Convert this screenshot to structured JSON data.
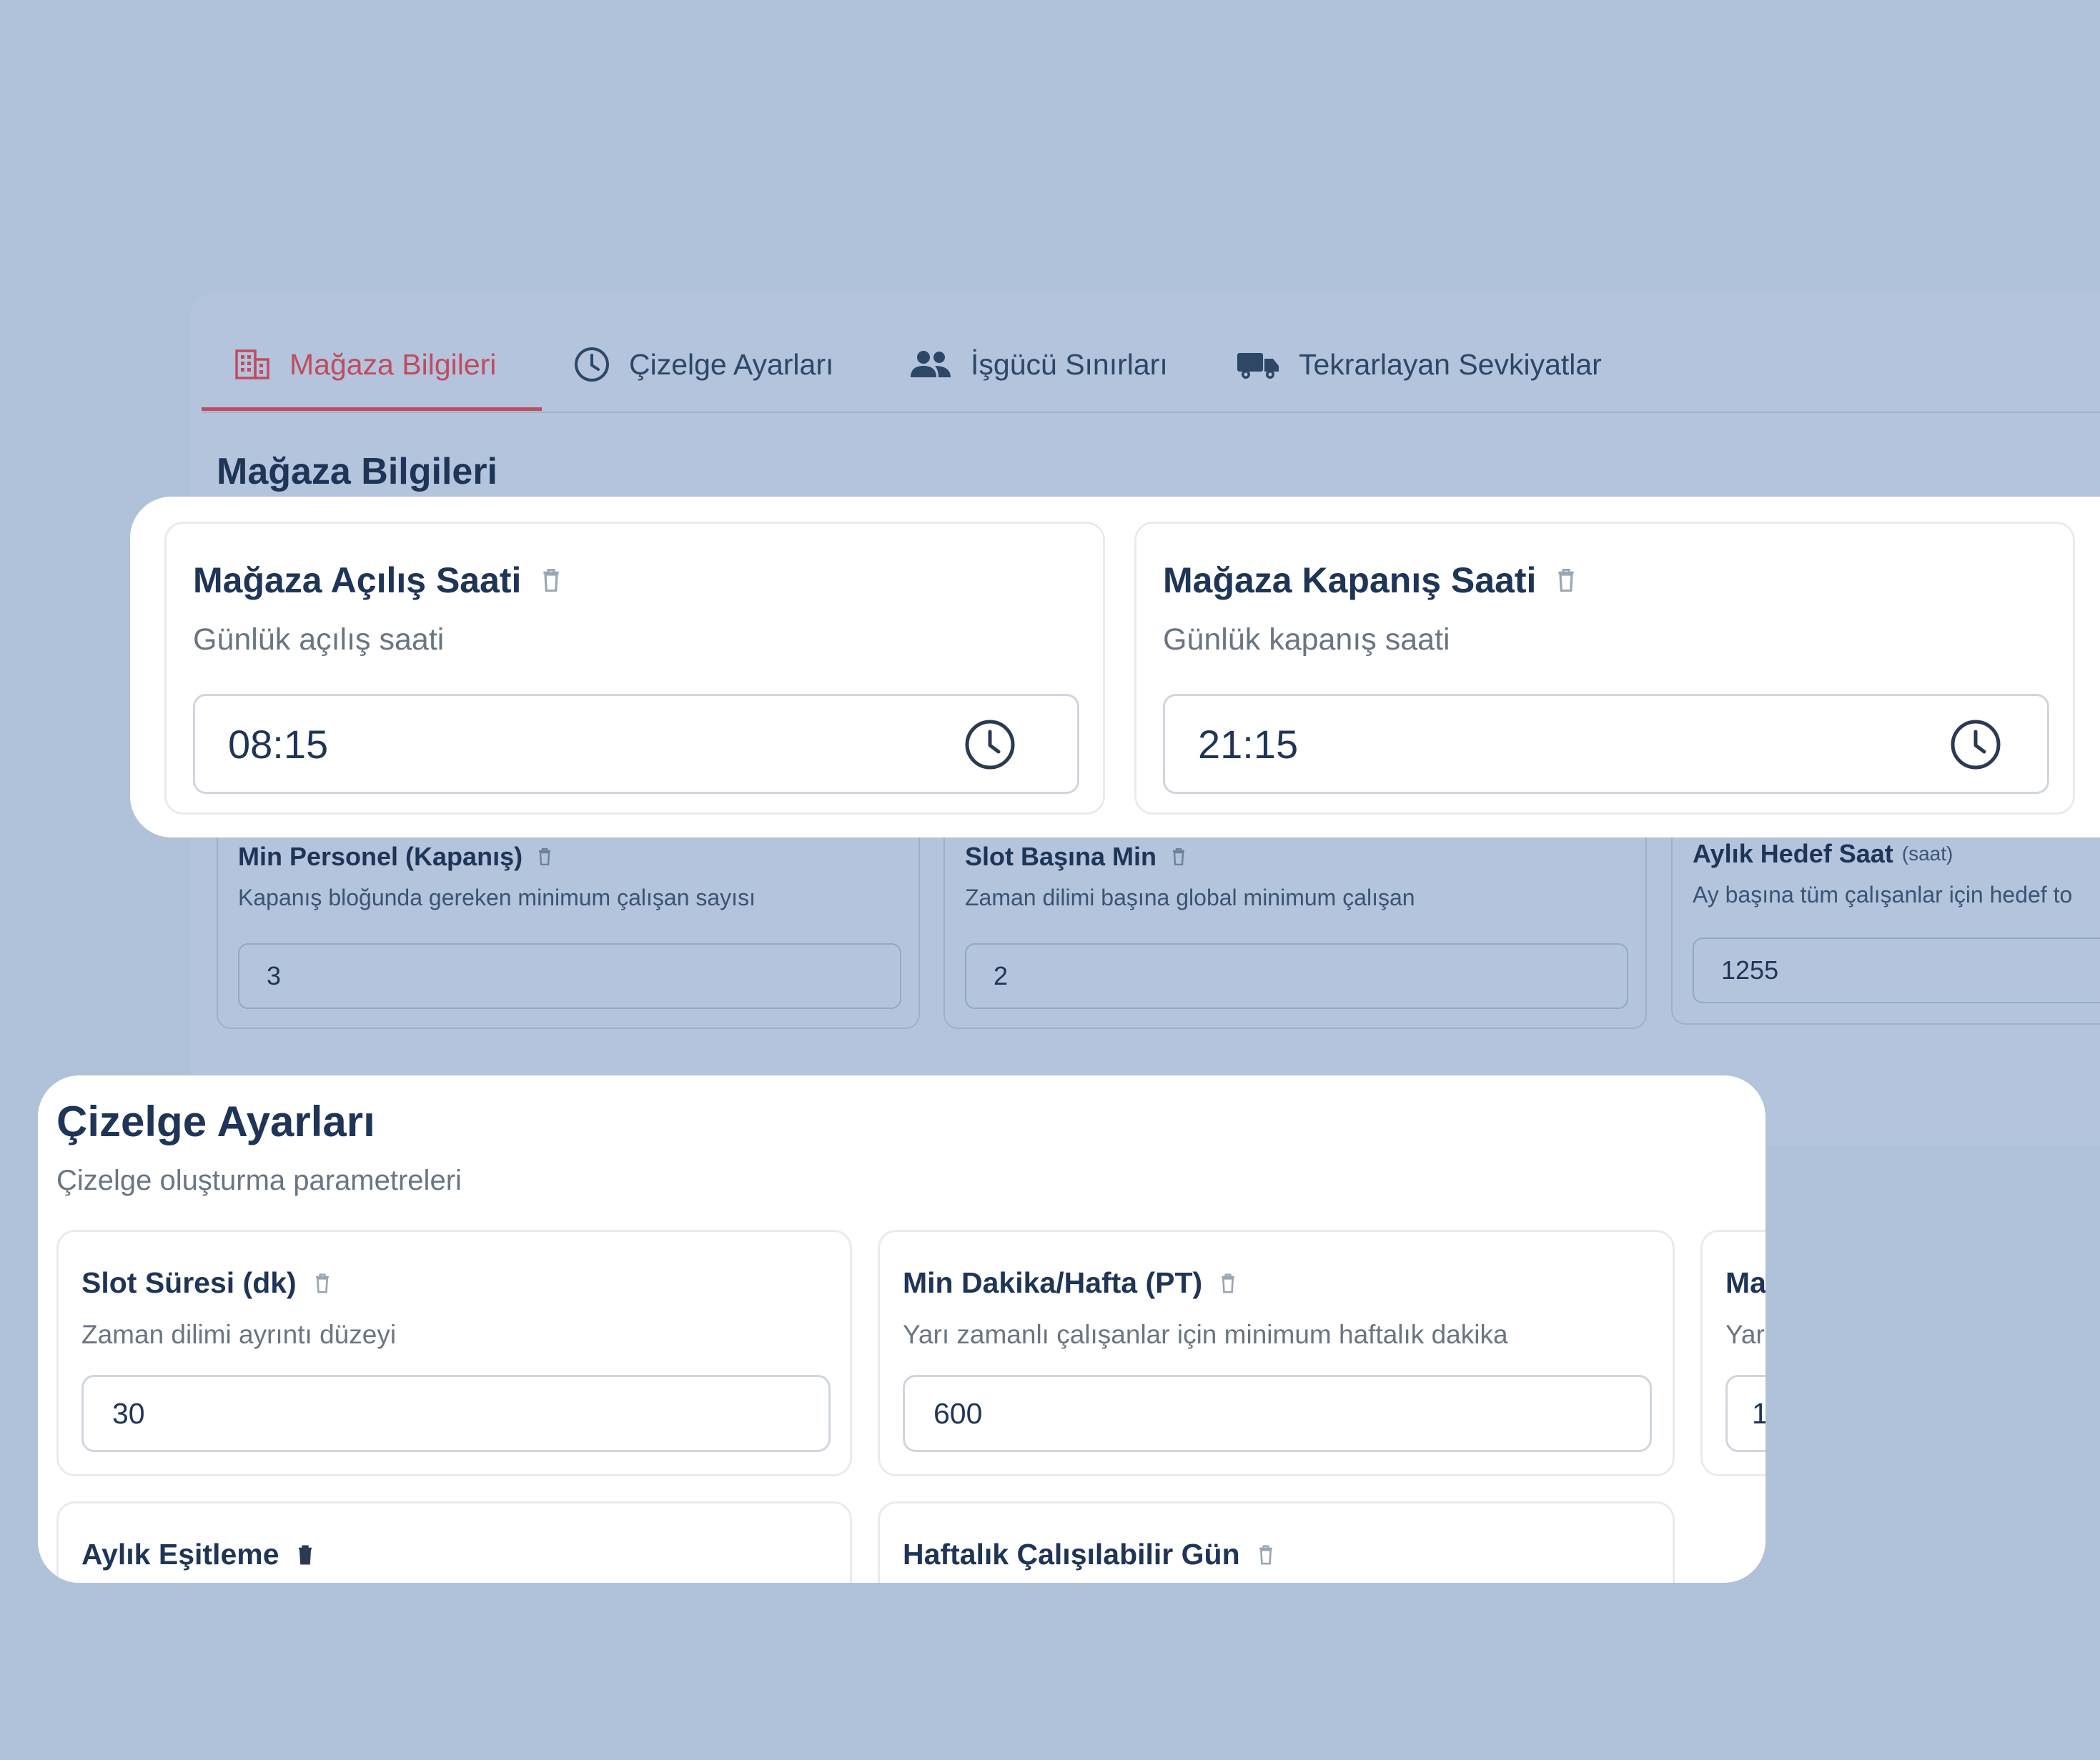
{
  "tabs": [
    {
      "label": "Mağaza Bilgileri",
      "icon": "building-icon",
      "active": true
    },
    {
      "label": "Çizelge Ayarları",
      "icon": "clock-icon"
    },
    {
      "label": "İşgücü Sınırları",
      "icon": "users-icon"
    },
    {
      "label": "Tekrarlayan Sevkiyatlar",
      "icon": "truck-icon"
    }
  ],
  "background_section": {
    "title": "Mağaza Bilgileri",
    "cards": [
      {
        "title": "Min Personel (Kapanış)",
        "desc": "Kapanış bloğunda gereken minimum çalışan sayısı",
        "value": "3"
      },
      {
        "title": "Slot Başına Min",
        "desc": "Zaman dilimi başına global minimum çalışan",
        "value": "2"
      },
      {
        "title": "Aylık Hedef Saat",
        "unit": "(saat)",
        "desc": "Ay başına tüm çalışanlar için hedef to",
        "value": "1255"
      }
    ]
  },
  "store_hours": {
    "opening": {
      "title": "Mağaza Açılış Saati",
      "desc": "Günlük açılış saati",
      "value": "08:15"
    },
    "closing": {
      "title": "Mağaza Kapanış Saati",
      "desc": "Günlük kapanış saati",
      "value": "21:15"
    }
  },
  "schedule_settings": {
    "title": "Çizelge Ayarları",
    "subtitle": "Çizelge oluşturma parametreleri",
    "cards": [
      {
        "title": "Slot Süresi (dk)",
        "desc": "Zaman dilimi ayrıntı düzeyi",
        "value": "30"
      },
      {
        "title": "Min Dakika/Hafta (PT)",
        "desc": "Yarı zamanlı çalışanlar için minimum haftalık dakika",
        "value": "600"
      },
      {
        "title": "Ma",
        "desc": "Yar",
        "value": "1"
      },
      {
        "title": "Aylık Eşitleme"
      },
      {
        "title": "Haftalık Çalışılabilir Gün"
      }
    ]
  },
  "colors": {
    "background": "#b0c2da",
    "accent": "#bf4c60",
    "text": "#1f3557",
    "card": "#ffffff"
  }
}
